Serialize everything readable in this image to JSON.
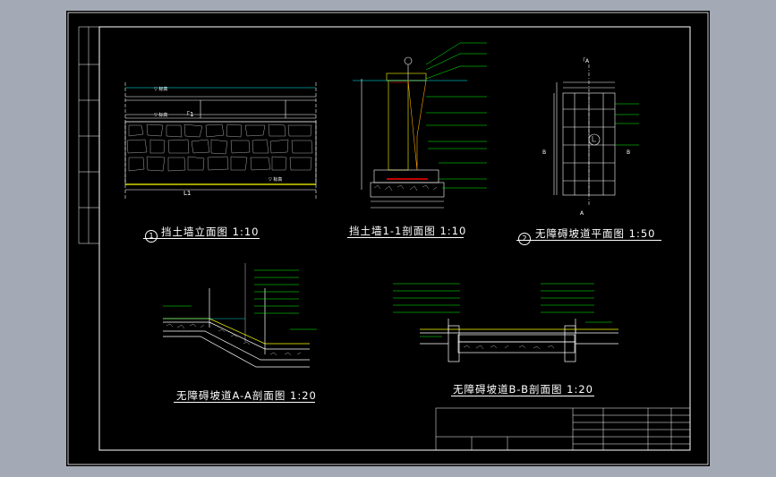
{
  "colors": {
    "background": "#a3aab5",
    "sheet": "#000000",
    "line": "#ffffff",
    "annotation": "#00ff00",
    "accent": "#ffff00",
    "cut": "#ff0000",
    "cyan": "#00ffff"
  },
  "titles": {
    "elevation": "挡土墙立面图 1:10",
    "section11": "挡土墙1-1剖面图 1:10",
    "plan": "无障碍坡道平面图 1:50",
    "sectionAA": "无障碍坡道A-A剖面图 1:20",
    "sectionBB": "无障碍坡道B-B剖面图 1:20"
  },
  "markers": {
    "elevation": "1",
    "plan": "2"
  }
}
